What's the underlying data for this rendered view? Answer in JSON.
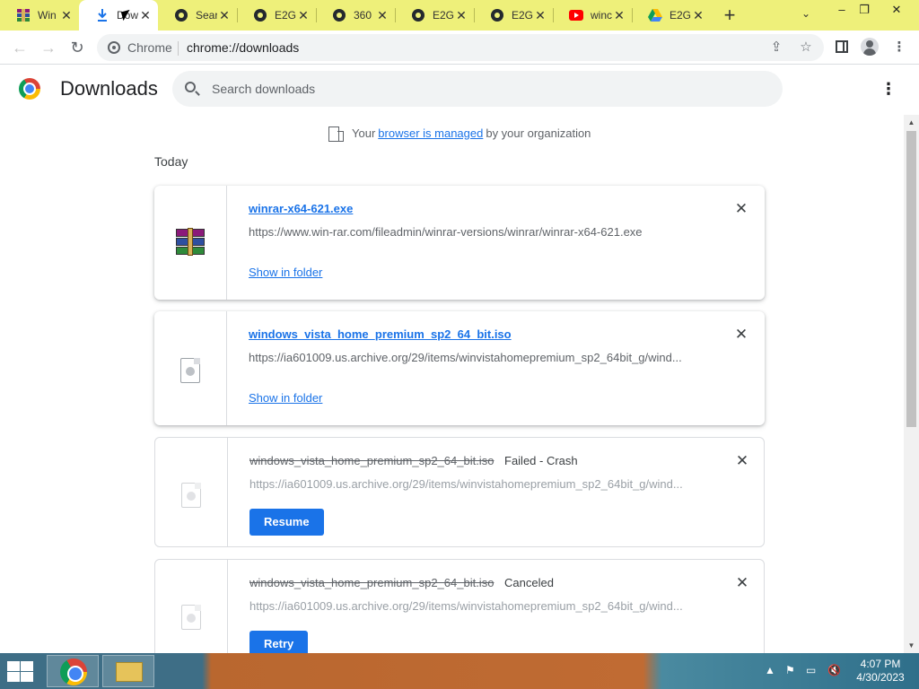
{
  "tabs": [
    {
      "title": "Win",
      "favicon": "winrar-icon",
      "active": false
    },
    {
      "title": "Dow",
      "favicon": "download-icon",
      "active": true
    },
    {
      "title": "Sear",
      "favicon": "github-icon",
      "active": false
    },
    {
      "title": "E2G",
      "favicon": "github-icon",
      "active": false
    },
    {
      "title": "360",
      "favicon": "github-icon",
      "active": false
    },
    {
      "title": "E2G",
      "favicon": "github-icon",
      "active": false
    },
    {
      "title": "E2G",
      "favicon": "github-icon",
      "active": false
    },
    {
      "title": "winc",
      "favicon": "youtube-icon",
      "active": false
    },
    {
      "title": "E2G",
      "favicon": "google-drive-icon",
      "active": false
    }
  ],
  "new_tab_label": "+",
  "window_controls": {
    "minimize": "–",
    "restore": "❐",
    "close": "✕"
  },
  "omnibox": {
    "chip": "Chrome",
    "url": "chrome://downloads"
  },
  "header": {
    "title": "Downloads",
    "search_placeholder": "Search downloads"
  },
  "managed": {
    "prefix": "Your",
    "link": "browser is managed",
    "suffix": "by your organization"
  },
  "section_label": "Today",
  "downloads": [
    {
      "filename": "winrar-x64-621.exe",
      "url": "https://www.win-rar.com/fileadmin/winrar-versions/winrar/winrar-x64-621.exe",
      "status": "",
      "action": "Show in folder",
      "icon": "winrar-icon"
    },
    {
      "filename": "windows_vista_home_premium_sp2_64_bit.iso",
      "url": "https://ia601009.us.archive.org/29/items/winvistahomepremium_sp2_64bit_g/wind...",
      "status": "",
      "action": "Show in folder",
      "icon": "disc-file-icon"
    },
    {
      "filename": "windows_vista_home_premium_sp2_64_bit.iso",
      "url": "https://ia601009.us.archive.org/29/items/winvistahomepremium_sp2_64bit_g/wind...",
      "status": "Failed - Crash",
      "action": "Resume",
      "icon": "disc-file-icon"
    },
    {
      "filename": "windows_vista_home_premium_sp2_64_bit.iso",
      "url": "https://ia601009.us.archive.org/29/items/winvistahomepremium_sp2_64bit_g/wind...",
      "status": "Canceled",
      "action": "Retry",
      "icon": "disc-file-icon"
    }
  ],
  "taskbar": {
    "time": "4:07 PM",
    "date": "4/30/2023"
  },
  "colors": {
    "accent": "#1a73e8",
    "tabstrip": "#eef07a",
    "text_secondary": "#5f6368"
  }
}
